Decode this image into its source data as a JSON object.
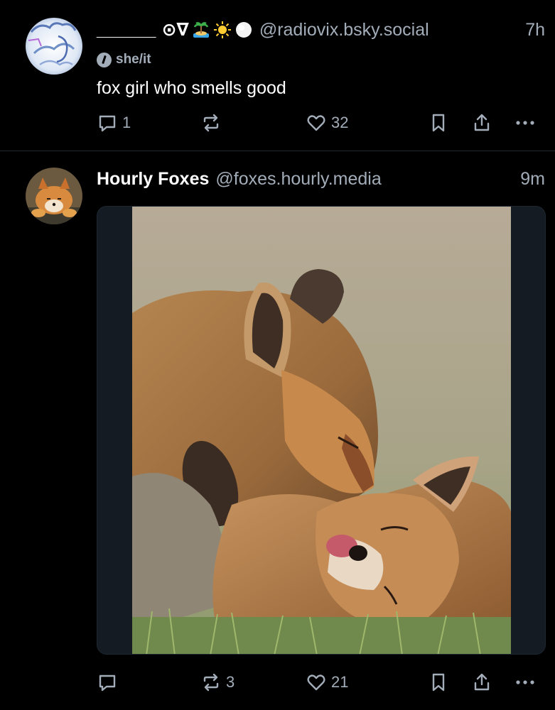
{
  "posts": [
    {
      "display_name": "______",
      "display_name_suffix": "⊙∇",
      "emoji": [
        "island-emoji",
        "sun-emoji",
        "white-circle-emoji"
      ],
      "handle": "@radiovix.bsky.social",
      "time": "7h",
      "pronouns": "she/it",
      "text": "fox girl who smells good",
      "actions": {
        "reply_count": "1",
        "repost_count": "",
        "like_count": "32"
      }
    },
    {
      "display_name": "Hourly Foxes",
      "handle": "@foxes.hourly.media",
      "time": "9m",
      "media_description_icon": "fox-photo",
      "actions": {
        "reply_count": "",
        "repost_count": "3",
        "like_count": "21"
      }
    }
  ],
  "colors": {
    "background": "#000000",
    "muted_text": "#a3adb9",
    "divider": "#222830"
  }
}
